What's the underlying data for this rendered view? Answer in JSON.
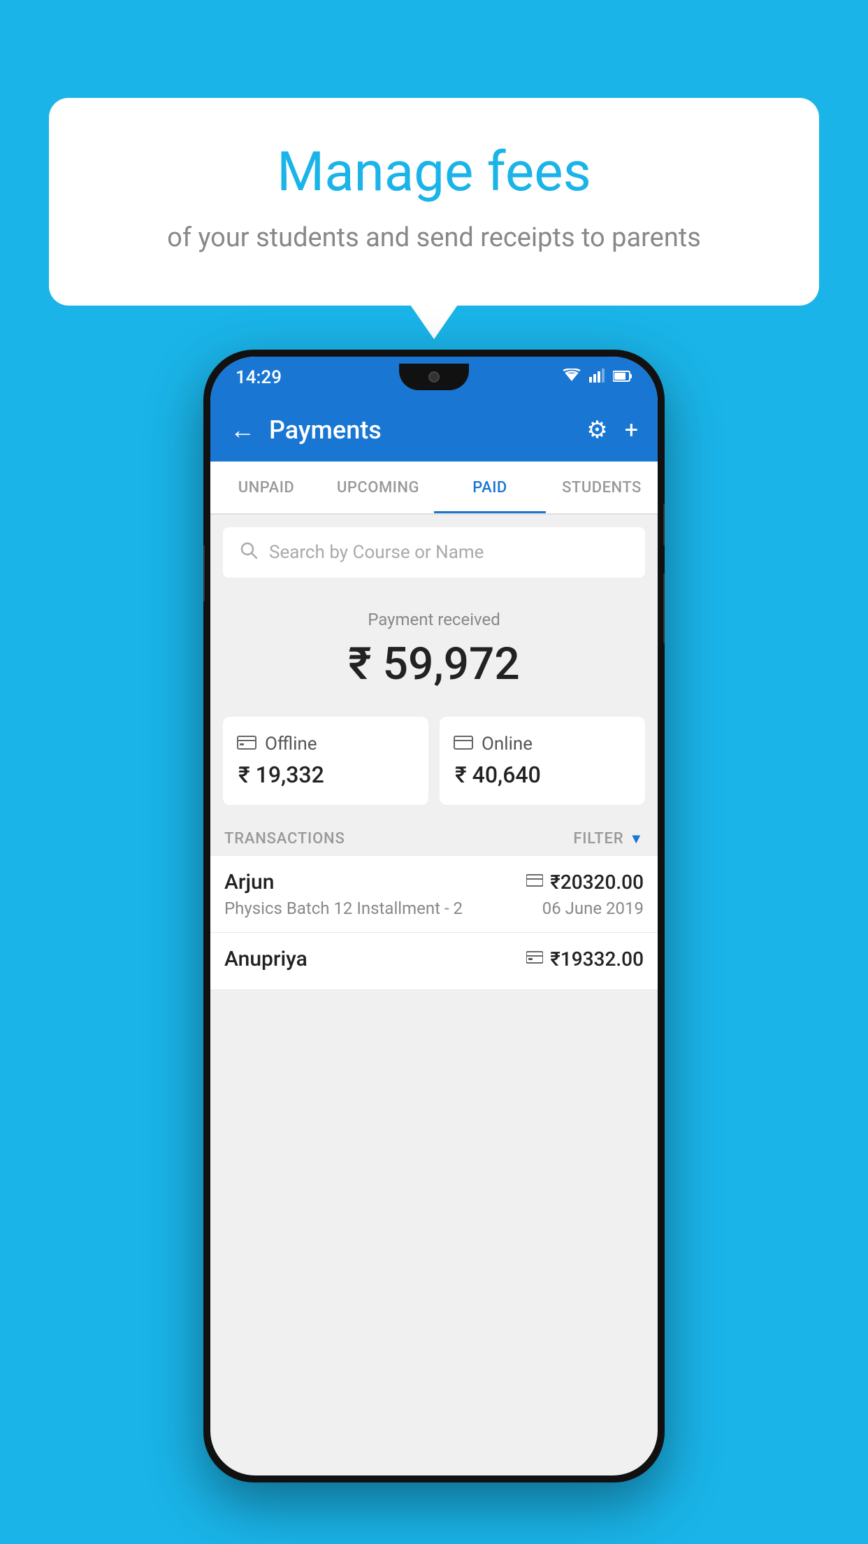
{
  "background_color": "#1ab4e8",
  "bubble": {
    "title": "Manage fees",
    "subtitle": "of your students and send receipts to parents"
  },
  "status_bar": {
    "time": "14:29",
    "wifi": "▲",
    "signal": "▲",
    "battery": "▉"
  },
  "app_bar": {
    "title": "Payments",
    "back_icon": "←",
    "gear_icon": "⚙",
    "plus_icon": "+"
  },
  "tabs": [
    {
      "label": "UNPAID",
      "active": false
    },
    {
      "label": "UPCOMING",
      "active": false
    },
    {
      "label": "PAID",
      "active": true
    },
    {
      "label": "STUDENTS",
      "active": false
    }
  ],
  "search": {
    "placeholder": "Search by Course or Name"
  },
  "payment_summary": {
    "label": "Payment received",
    "amount": "₹ 59,972",
    "offline_label": "Offline",
    "offline_amount": "₹ 19,332",
    "online_label": "Online",
    "online_amount": "₹ 40,640"
  },
  "transactions": {
    "header": "TRANSACTIONS",
    "filter": "FILTER",
    "rows": [
      {
        "name": "Arjun",
        "course": "Physics Batch 12 Installment - 2",
        "amount": "₹20320.00",
        "date": "06 June 2019",
        "type": "online"
      },
      {
        "name": "Anupriya",
        "course": "",
        "amount": "₹19332.00",
        "date": "",
        "type": "offline"
      }
    ]
  }
}
